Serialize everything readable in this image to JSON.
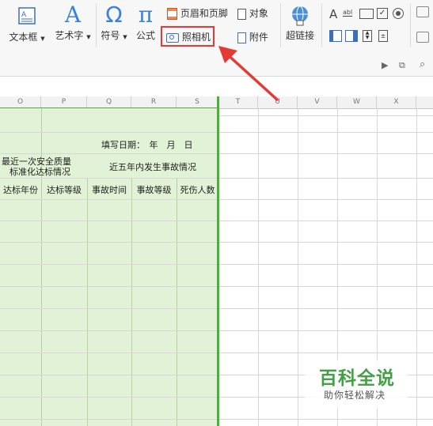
{
  "ribbon": {
    "textbox": "文本框",
    "wordart": "艺术字",
    "symbol": "符号",
    "formula": "公式",
    "header_footer": "页眉和页脚",
    "object": "对象",
    "camera": "照相机",
    "attachment": "附件",
    "hyperlink": "超链接",
    "symbol_glyph": "Ω",
    "formula_glyph": "π",
    "wordart_glyph": "A"
  },
  "columns": [
    "O",
    "P",
    "Q",
    "R",
    "S",
    "T",
    "U",
    "V",
    "W",
    "X"
  ],
  "table": {
    "fill_date": "填写日期：　年　月　日",
    "recent_safety": "最近一次安全质量",
    "recent_safety2": "标准化达标情况",
    "five_year": "近五年内发生事故情况",
    "h_year": "达标年份",
    "h_level": "达标等级",
    "h_time": "事故时间",
    "h_acc_level": "事故等级",
    "h_casualty": "死伤人数"
  },
  "watermark": {
    "title": "百科全说",
    "subtitle": "助你轻松解决"
  },
  "colors": {
    "accent_green": "#4caf3a",
    "highlight_red": "#e53935",
    "sheet_green": "#e1f2d6"
  }
}
